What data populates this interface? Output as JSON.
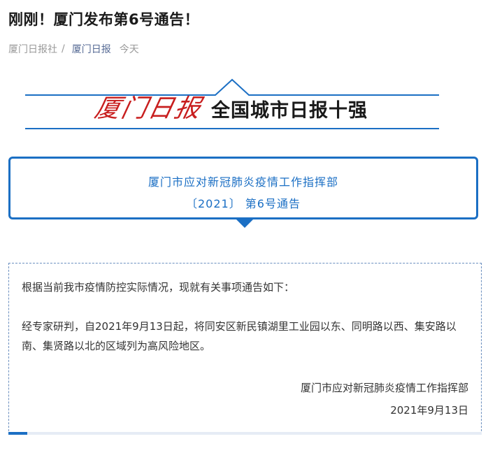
{
  "article": {
    "title": "刚刚！厦门发布第6号通告！",
    "source": "厦门日报社",
    "separator": "/",
    "account": "厦门日报",
    "time": "今天"
  },
  "banner": {
    "logo_text": "厦门日报",
    "slogan": "全国城市日报十强"
  },
  "notice": {
    "issuer": "厦门市应对新冠肺炎疫情工作指挥部",
    "number": "〔2021〕 第6号通告"
  },
  "content": {
    "intro": "根据当前我市疫情防控实际情况，现就有关事项通告如下：",
    "body": "经专家研判，自2021年9月13日起，将同安区新民镇湖里工业园以东、同明路以西、集安路以南、集贤路以北的区域列为高风险地区。",
    "signature": "厦门市应对新冠肺炎疫情工作指挥部",
    "date": "2021年9月13日"
  },
  "progress": {
    "fraction": 0.04
  },
  "colors": {
    "accent": "#1b6fc4",
    "logo_red": "#c81e1e",
    "link": "#576b95"
  }
}
